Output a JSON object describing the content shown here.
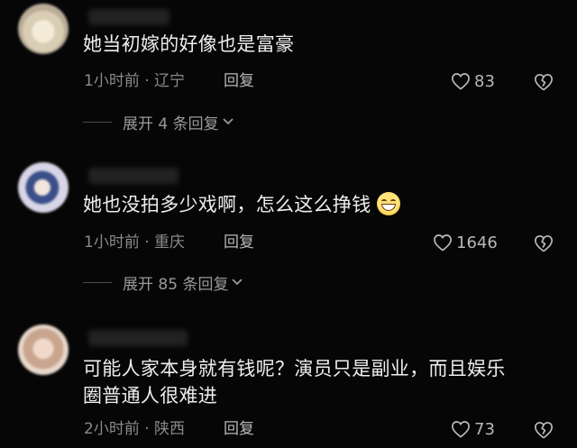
{
  "comments": [
    {
      "text": "她当初嫁的好像也是富豪",
      "time": "1小时前",
      "location": "辽宁",
      "reply_label": "回复",
      "likes": "83",
      "expand_label": "展开 4 条回复"
    },
    {
      "text": "她也没拍多少戏啊，怎么这么挣钱",
      "emoji": "grinning-face-icon",
      "time": "1小时前",
      "location": "重庆",
      "reply_label": "回复",
      "likes": "1646",
      "expand_label": "展开 85 条回复"
    },
    {
      "text_line1": "可能人家本身就有钱呢？演员只是副业，而且娱乐",
      "text_line2": "圈普通人很难进",
      "time": "2小时前",
      "location": "陕西",
      "reply_label": "回复",
      "likes": "73"
    }
  ],
  "meta_separator": " · ",
  "colors": {
    "background": "#060606",
    "text": "#eeeeee",
    "meta": "#8a8a8a"
  }
}
